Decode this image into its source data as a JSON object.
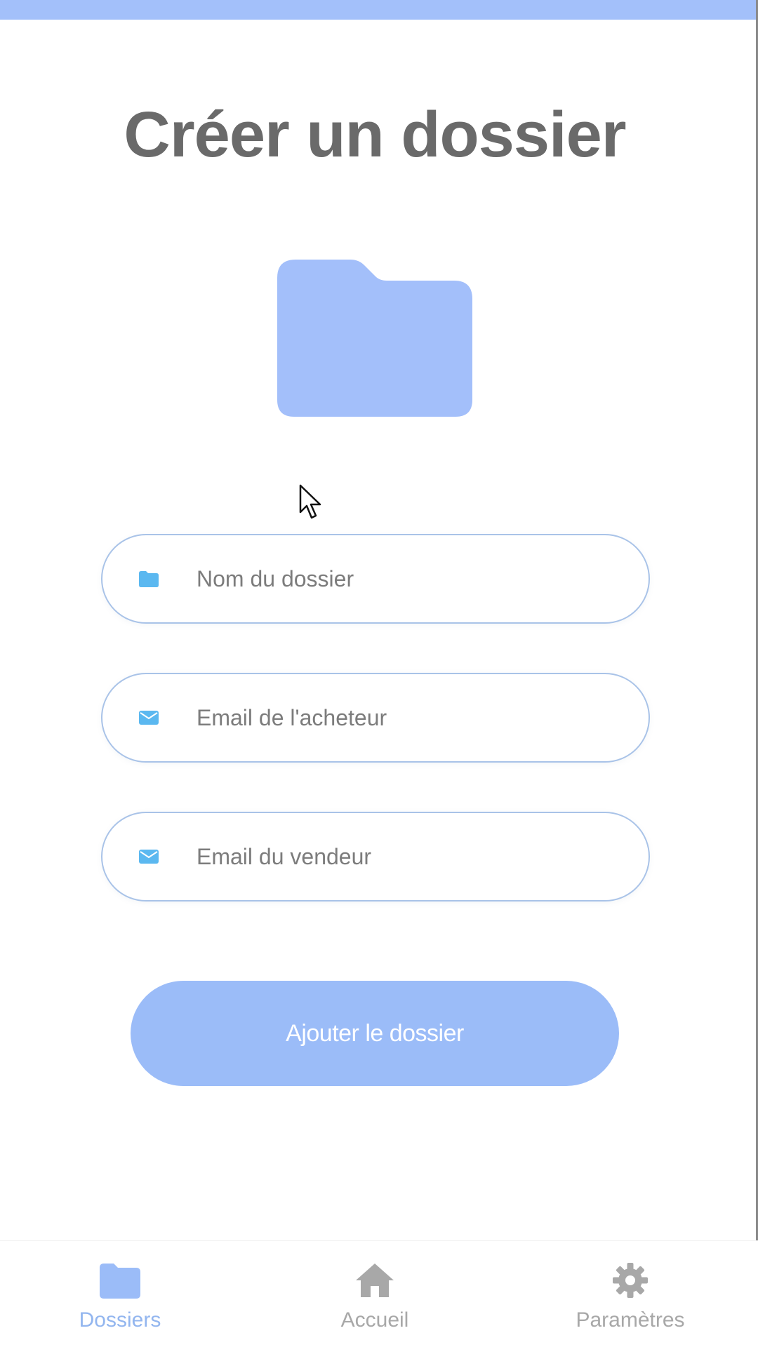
{
  "page": {
    "title": "Créer un dossier"
  },
  "form": {
    "folder_name": {
      "placeholder": "Nom du dossier",
      "value": "",
      "icon": "folder-icon"
    },
    "buyer_email": {
      "placeholder": "Email de l'acheteur",
      "value": "",
      "icon": "mail-icon"
    },
    "seller_email": {
      "placeholder": "Email du vendeur",
      "value": "",
      "icon": "mail-icon"
    },
    "submit_label": "Ajouter le dossier"
  },
  "tab_bar": {
    "items": [
      {
        "label": "Dossiers",
        "icon": "folder-icon",
        "active": true
      },
      {
        "label": "Accueil",
        "icon": "home-icon",
        "active": false
      },
      {
        "label": "Paramètres",
        "icon": "gear-icon",
        "active": false
      }
    ]
  },
  "colors": {
    "accent": "#9bbcf8",
    "status_bar": "#a3c0fa",
    "field_icon": "#5bb8f0",
    "field_border": "#a9c3e8",
    "title_text": "#6a6a6a",
    "inactive_tab": "#a8a8a8",
    "active_tab": "#93b6ef"
  }
}
